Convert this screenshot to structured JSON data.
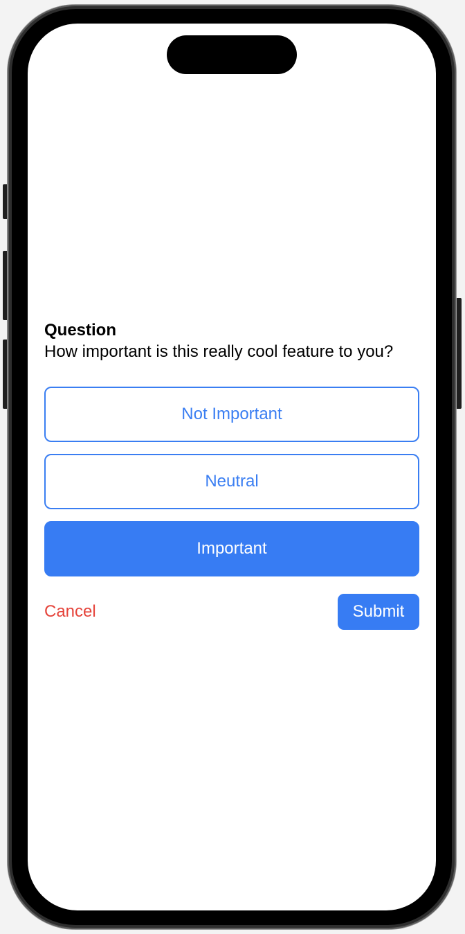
{
  "question": {
    "title": "Question",
    "text": "How important is this really cool feature to you?"
  },
  "options": [
    {
      "label": "Not Important",
      "selected": false
    },
    {
      "label": "Neutral",
      "selected": false
    },
    {
      "label": "Important",
      "selected": true
    }
  ],
  "actions": {
    "cancel_label": "Cancel",
    "submit_label": "Submit"
  },
  "colors": {
    "accent": "#377cf3",
    "destructive": "#e5433a",
    "background": "#ffffff"
  }
}
